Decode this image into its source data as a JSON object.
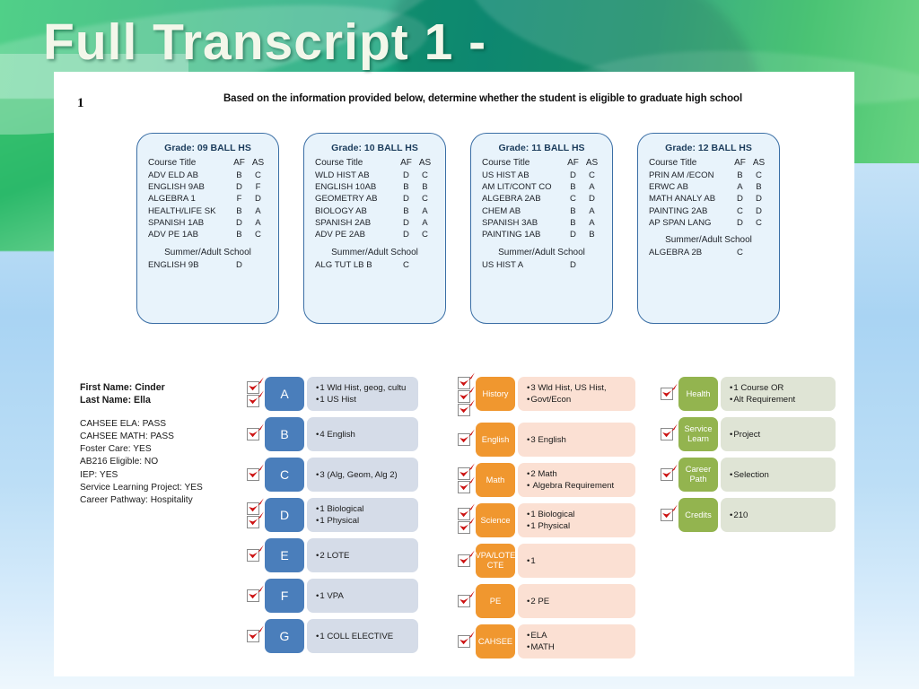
{
  "slide": {
    "title": "Full Transcript 1 -",
    "number": "1",
    "prompt": "Based on the information provided below, determine whether the student is eligible to graduate high school",
    "accent_green": "#17a877",
    "background_blue": "#a9d4f3"
  },
  "grade_cards": [
    {
      "title": "Grade: 09 BALL HS",
      "columns": [
        "Course Title",
        "AF",
        "AS"
      ],
      "courses": [
        {
          "title": "ADV ELD AB",
          "af": "B",
          "as": "C"
        },
        {
          "title": "ENGLISH  9AB",
          "af": "D",
          "as": "F"
        },
        {
          "title": "ALGEBRA 1",
          "af": "F",
          "as": "D"
        },
        {
          "title": "HEALTH/LIFE SK",
          "af": "B",
          "as": "A"
        },
        {
          "title": "SPANISH 1AB",
          "af": "D",
          "as": "A"
        },
        {
          "title": "ADV PE 1AB",
          "af": "B",
          "as": "C"
        }
      ],
      "summer_label": "Summer/Adult School",
      "summer": [
        {
          "title": "ENGLISH  9B",
          "af": "D",
          "as": ""
        }
      ]
    },
    {
      "title": "Grade: 10 BALL HS",
      "columns": [
        "Course Title",
        "AF",
        "AS"
      ],
      "courses": [
        {
          "title": "WLD HIST AB",
          "af": "D",
          "as": "C"
        },
        {
          "title": "ENGLISH  10AB",
          "af": "B",
          "as": "B"
        },
        {
          "title": "GEOMETRY  AB",
          "af": "D",
          "as": "C"
        },
        {
          "title": "BIOLOGY AB",
          "af": "B",
          "as": "A"
        },
        {
          "title": "SPANISH 2AB",
          "af": "D",
          "as": "A"
        },
        {
          "title": "ADV PE 2AB",
          "af": "D",
          "as": "C"
        }
      ],
      "summer_label": "Summer/Adult School",
      "summer": [
        {
          "title": "ALG TUT LB B",
          "af": "C",
          "as": ""
        }
      ]
    },
    {
      "title": "Grade: 11 BALL HS",
      "columns": [
        "Course Title",
        "AF",
        "AS"
      ],
      "courses": [
        {
          "title": "US HIST AB",
          "af": "D",
          "as": "C"
        },
        {
          "title": "AM LIT/CONT CO",
          "af": "B",
          "as": "A"
        },
        {
          "title": "ALGEBRA 2AB",
          "af": "C",
          "as": "D"
        },
        {
          "title": "CHEM AB",
          "af": "B",
          "as": "A"
        },
        {
          "title": "SPANISH 3AB",
          "af": "B",
          "as": "A"
        },
        {
          "title": "PAINTING 1AB",
          "af": "D",
          "as": "B"
        }
      ],
      "summer_label": "Summer/Adult School",
      "summer": [
        {
          "title": "US HIST A",
          "af": "D",
          "as": ""
        }
      ]
    },
    {
      "title": "Grade: 12 BALL HS",
      "columns": [
        "Course Title",
        "AF",
        "AS"
      ],
      "courses": [
        {
          "title": "PRIN AM /ECON",
          "af": "B",
          "as": "C"
        },
        {
          "title": "ERWC AB",
          "af": "A",
          "as": "B"
        },
        {
          "title": "MATH ANALY AB",
          "af": "D",
          "as": "D"
        },
        {
          "title": "PAINTING  2AB",
          "af": "C",
          "as": "D"
        },
        {
          "title": "AP SPAN LANG",
          "af": "D",
          "as": "C"
        }
      ],
      "summer_label": "Summer/Adult School",
      "summer": [
        {
          "title": "ALGEBRA 2B",
          "af": "C",
          "as": ""
        }
      ]
    }
  ],
  "student": {
    "first_name_label": "First Name: Cinder",
    "last_name_label": "Last Name: Ella",
    "facts": [
      "CAHSEE ELA: PASS",
      "CAHSEE MATH: PASS",
      "Foster Care: YES",
      "AB216 Eligible: NO",
      "IEP: YES",
      "Service Learning Project: YES",
      "Career Pathway: Hospitality"
    ]
  },
  "requirement_columns": [
    {
      "id": "a-g",
      "accent": "#4a7ebb",
      "desc_bg": "#d5dce8",
      "rows": [
        {
          "tag": "A",
          "checks": 2,
          "lines": [
            "1 Wld Hist, geog, cultu",
            "1 US Hist"
          ]
        },
        {
          "tag": "B",
          "checks": 1,
          "lines": [
            "4 English"
          ]
        },
        {
          "tag": "C",
          "checks": 1,
          "lines": [
            "3 (Alg, Geom, Alg 2)"
          ]
        },
        {
          "tag": "D",
          "checks": 2,
          "lines": [
            "1 Biological",
            "1 Physical"
          ]
        },
        {
          "tag": "E",
          "checks": 1,
          "lines": [
            "2 LOTE"
          ]
        },
        {
          "tag": "F",
          "checks": 1,
          "lines": [
            "1 VPA"
          ]
        },
        {
          "tag": "G",
          "checks": 1,
          "lines": [
            "1 COLL ELECTIVE"
          ]
        }
      ]
    },
    {
      "id": "district",
      "accent": "#f0972f",
      "desc_bg": "#fbe0d3",
      "rows": [
        {
          "tag": "History",
          "checks": 3,
          "lines": [
            "3 Wld Hist, US Hist,",
            "Govt/Econ"
          ]
        },
        {
          "tag": "English",
          "checks": 1,
          "lines": [
            "3 English"
          ]
        },
        {
          "tag": "Math",
          "checks": 2,
          "lines": [
            "2 Math",
            " Algebra Requirement"
          ]
        },
        {
          "tag": "Science",
          "checks": 2,
          "lines": [
            "1 Biological",
            "1 Physical"
          ]
        },
        {
          "tag": "VPA/LOTE CTE",
          "checks": 1,
          "lines": [
            "1"
          ]
        },
        {
          "tag": "PE",
          "checks": 1,
          "lines": [
            "2 PE"
          ]
        },
        {
          "tag": "CAHSEE",
          "checks": 1,
          "lines": [
            "ELA",
            "MATH"
          ]
        }
      ]
    },
    {
      "id": "other",
      "accent": "#93b44f",
      "desc_bg": "#dfe4d5",
      "rows": [
        {
          "tag": "Health",
          "checks": 1,
          "lines": [
            "1 Course OR",
            "Alt Requirement"
          ]
        },
        {
          "tag": "Service Learn",
          "checks": 1,
          "lines": [
            "Project"
          ]
        },
        {
          "tag": "Career Path",
          "checks": 1,
          "lines": [
            "Selection"
          ]
        },
        {
          "tag": "Credits",
          "checks": 1,
          "lines": [
            "210"
          ]
        }
      ]
    }
  ],
  "icons": {
    "checkmark": "red-checkmark-icon",
    "checkbox": "checkbox-icon"
  }
}
